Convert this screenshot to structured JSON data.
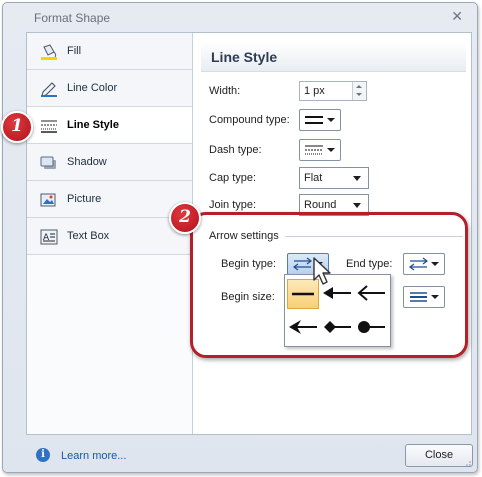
{
  "window": {
    "title": "Format Shape",
    "close_glyph": "✕"
  },
  "sidebar": {
    "items": [
      {
        "label": "Fill",
        "icon": "paint-bucket-icon"
      },
      {
        "label": "Line Color",
        "icon": "pencil-icon"
      },
      {
        "label": "Line Style",
        "icon": "line-style-icon",
        "selected": true
      },
      {
        "label": "Shadow",
        "icon": "shadow-icon"
      },
      {
        "label": "Picture",
        "icon": "picture-icon"
      },
      {
        "label": "Text Box",
        "icon": "text-box-icon"
      }
    ]
  },
  "panel": {
    "title": "Line Style",
    "width": {
      "label": "Width:",
      "value": "1 px"
    },
    "compound_type": {
      "label": "Compound type:"
    },
    "dash_type": {
      "label": "Dash type:"
    },
    "cap_type": {
      "label": "Cap type:",
      "value": "Flat"
    },
    "join_type": {
      "label": "Join type:",
      "value": "Round"
    },
    "arrow_settings": {
      "group_label": "Arrow settings",
      "begin_type_label": "Begin type:",
      "end_type_label": "End type:",
      "begin_size_label": "Begin size:"
    }
  },
  "annotations": {
    "badge1": "1",
    "badge2": "2"
  },
  "footer": {
    "learn_more": "Learn more...",
    "close_label": "Close",
    "info_glyph": "i"
  },
  "colors": {
    "annotation_red": "#b31f2a",
    "highlight_orange": "#f9cf77",
    "accent_blue": "#2f72c3"
  }
}
